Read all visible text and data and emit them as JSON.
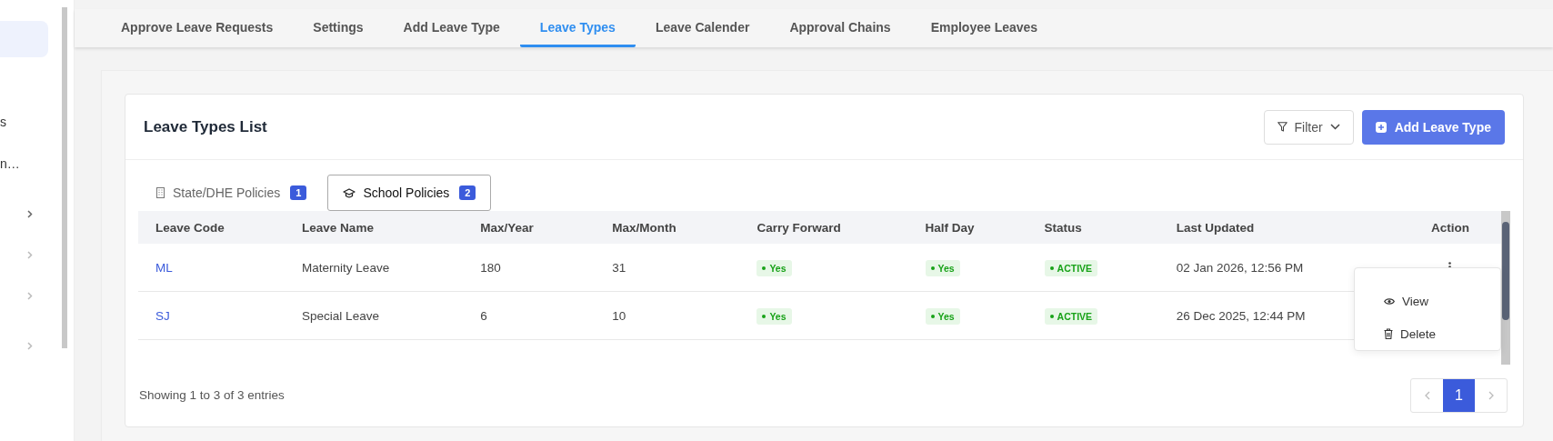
{
  "sidebar": {
    "items": [
      {
        "kind": "blank",
        "selected": true
      },
      {
        "kind": "text",
        "label": "s",
        "selected": false
      },
      {
        "kind": "text",
        "label": "n…",
        "selected": false
      },
      {
        "kind": "group",
        "selected": false
      },
      {
        "kind": "group",
        "selected": false
      },
      {
        "kind": "group",
        "selected": false
      },
      {
        "kind": "group",
        "selected": false
      }
    ]
  },
  "tabs": [
    {
      "label": "Approve Leave Requests",
      "selected": false
    },
    {
      "label": "Settings",
      "selected": false
    },
    {
      "label": "Add Leave Type",
      "selected": false
    },
    {
      "label": "Leave Types",
      "selected": true
    },
    {
      "label": "Leave Calender",
      "selected": false
    },
    {
      "label": "Approval Chains",
      "selected": false
    },
    {
      "label": "Employee Leaves",
      "selected": false
    }
  ],
  "card": {
    "title": "Leave Types List",
    "filter_button": "Filter",
    "add_button": "Add Leave Type",
    "policy_tabs": [
      {
        "kind": "building",
        "label": "State/DHE Policies",
        "count": "1",
        "selected": false
      },
      {
        "kind": "cap",
        "label": "School Policies",
        "count": "2",
        "selected": true
      }
    ],
    "table": {
      "columns": [
        "Leave Code",
        "Leave Name",
        "Max/Year",
        "Max/Month",
        "Carry Forward",
        "Half Day",
        "Status",
        "Last Updated",
        "Action"
      ],
      "rows": [
        {
          "code": "ML",
          "name": "Maternity Leave",
          "max_year": "180",
          "max_month": "31",
          "carry_forward": "Yes",
          "half_day": "Yes",
          "status": "ACTIVE",
          "last_updated": "02 Jan 2026, 12:56 PM",
          "menu_open": true
        },
        {
          "code": "SJ",
          "name": "Special Leave",
          "max_year": "6",
          "max_month": "10",
          "carry_forward": "Yes",
          "half_day": "Yes",
          "status": "ACTIVE",
          "last_updated": "26 Dec 2025, 12:44 PM",
          "menu_open": false
        }
      ]
    },
    "action_menu": {
      "items": [
        {
          "kind": "view",
          "label": "View"
        },
        {
          "kind": "delete",
          "label": "Delete"
        }
      ]
    },
    "footer": {
      "summary": "Showing 1 to 3 of 3 entries",
      "pages": [
        {
          "label": "1",
          "selected": true
        }
      ],
      "prev_disabled": true,
      "next_disabled": true
    }
  }
}
